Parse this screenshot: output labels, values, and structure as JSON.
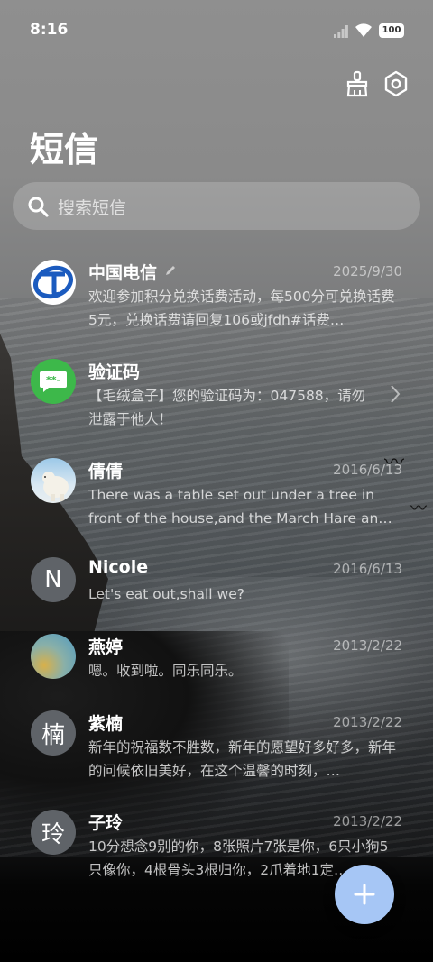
{
  "status_bar": {
    "time": "8:16",
    "battery": "100"
  },
  "header": {
    "title": "短信"
  },
  "search": {
    "placeholder": "搜索短信"
  },
  "conversations": [
    {
      "name": "中国电信",
      "date": "2025/9/30",
      "preview": "欢迎参加积分兑换话费活动，每500分可兑换话费5元，兑换话费请回复106或jfdh#话费…",
      "avatar": "china-telecom-logo"
    },
    {
      "name": "验证码",
      "date": "",
      "preview": "【毛绒盒子】您的验证码为：047588，请勿泄露于他人！",
      "avatar": "message-code-icon"
    },
    {
      "name": "倩倩",
      "date": "2016/6/13",
      "preview": "There was a table set out under a tree in front of the house,and the March Hare an…",
      "avatar": "polar-bear-photo"
    },
    {
      "name": "Nicole",
      "date": "2016/6/13",
      "preview": "Let's eat out,shall we?",
      "avatar_letter": "N"
    },
    {
      "name": "燕婷",
      "date": "2013/2/22",
      "preview": "嗯。收到啦。同乐同乐。",
      "avatar": "landscape-photo"
    },
    {
      "name": "紫楠",
      "date": "2013/2/22",
      "preview": "新年的祝福数不胜数，新年的愿望好多好多，新年的问候依旧美好，在这个温馨的时刻，…",
      "avatar_letter": "楠"
    },
    {
      "name": "子玲",
      "date": "2013/2/22",
      "preview": "10分想念9别的你，8张照片7张是你，6只小狗5只像你，4根骨头3根归你，2爪着地1定…",
      "avatar_letter": "玲"
    }
  ],
  "colors": {
    "fab": "#a6c6f5",
    "telecom_blue": "#1b5bbf",
    "code_green": "#3db84a"
  }
}
